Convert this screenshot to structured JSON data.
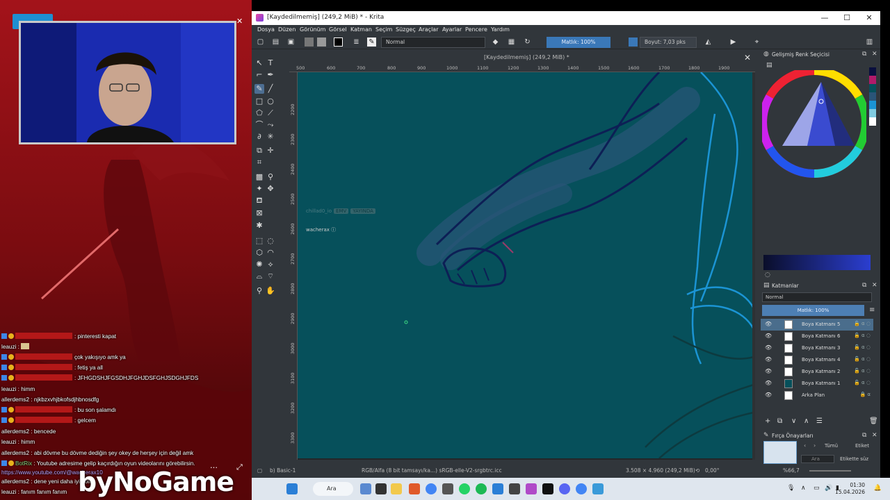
{
  "stream": {
    "chat_lines": [
      {
        "user": "",
        "text": ": pinteresti kapat",
        "badges": 2,
        "redacted": true
      },
      {
        "user": "leauzi",
        "text": " : ",
        "badges": 0,
        "redacted": false
      },
      {
        "user": "",
        "text": "çok yakışıyo amk ya",
        "badges": 2,
        "redacted": true
      },
      {
        "user": "",
        "text": ": fetiş ya all",
        "badges": 2,
        "redacted": true
      },
      {
        "user": "",
        "text": ": JFHGDSHJFGSDHJFGHJDSFGHJSDGHJFDS",
        "badges": 2,
        "redacted": true
      },
      {
        "user": "leauzi",
        "text": " : himm",
        "badges": 0,
        "redacted": false
      },
      {
        "user": "allerdems2",
        "text": " : njkbzxvhjbkofsdjhbnosdfg",
        "badges": 0,
        "redacted": false
      },
      {
        "user": "",
        "text": ": bu son şalamdı",
        "badges": 2,
        "redacted": true
      },
      {
        "user": "",
        "text": ": gelcem",
        "badges": 2,
        "redacted": true
      },
      {
        "user": "allerdems2",
        "text": " : bencede",
        "badges": 0,
        "redacted": false
      },
      {
        "user": "leauzi",
        "text": " : himm",
        "badges": 0,
        "redacted": false
      },
      {
        "user": "allerdems2",
        "text": " : abi dövme bu dövme dediğin şey okey de herşey için değil amk",
        "badges": 0,
        "redacted": false
      },
      {
        "user": "BotRix",
        "text": " : Youtube adresime gelip kaçırdığın oyun videolarını görebilirsin.",
        "badges": 2,
        "redacted": false
      },
      {
        "user": "",
        "text": "https://www.youtube.com/@wacherax10",
        "badges": 0,
        "redacted": false,
        "link": true
      },
      {
        "user": "allerdems2",
        "text": " : dene yeni daha iyi nolll",
        "badges": 0,
        "redacted": false
      },
      {
        "user": "leauzi",
        "text": " : fanım fanım fanım",
        "badges": 0,
        "redacted": false
      }
    ],
    "logo": "byNoGame"
  },
  "krita": {
    "title": "[Kaydedilmemiş] (249,2 MiB) * - Krita",
    "window_buttons": [
      "—",
      "☐",
      "✕"
    ],
    "menu": [
      "Dosya",
      "Düzen",
      "Görünüm",
      "Görsel",
      "Katman",
      "Seçim",
      "Süzgeç",
      "Araçlar",
      "Ayarlar",
      "Pencere",
      "Yardım"
    ],
    "toolbar": {
      "blend_mode": "Normal",
      "opacity": "Matlık: 100%",
      "size": "Boyut: 7,03 pks"
    },
    "doc_tab": "[Kaydedilmemiş] (249,2 MiB) *",
    "ruler_top": [
      "500",
      "600",
      "700",
      "800",
      "900",
      "1000",
      "1100",
      "1200",
      "1300",
      "1400",
      "1500",
      "1600",
      "1700",
      "1800",
      "1900"
    ],
    "ruler_left": [
      "2200",
      "2300",
      "2400",
      "2500",
      "2600",
      "2700",
      "2800",
      "2900",
      "3000",
      "3100",
      "3200",
      "3300",
      "3400"
    ],
    "canvas_overlay": {
      "user": "wacherax",
      "ghost_user": "chillad0_io",
      "ghost_tag1": "EMV",
      "ghost_tag2": "YAYINDA"
    },
    "status": {
      "brush": "b) Basic-1",
      "colorspace": "RGB/Alfa (8 bit tamsayı/ka...) sRGB-elle-V2-srgbtrc.icc",
      "dimensions": "3.508 × 4.960 (249,2 MiB)",
      "rotation": "0,00°",
      "zoom": "%66,7"
    },
    "dockers": {
      "color_selector_title": "Gelişmiş Renk Seçicisi",
      "layers_title": "Katmanlar",
      "layers_blend": "Normal",
      "layers_opacity": "Matlık: 100%",
      "layers": [
        {
          "name": "Boya Katmanı 5",
          "selected": true
        },
        {
          "name": "Boya Katmanı 6",
          "selected": false
        },
        {
          "name": "Boya Katmanı 3",
          "selected": false
        },
        {
          "name": "Boya Katmanı 4",
          "selected": false
        },
        {
          "name": "Boya Katmanı 2",
          "selected": false
        },
        {
          "name": "Boya Katmanı 1",
          "selected": false
        },
        {
          "name": "Arka Plan",
          "selected": false
        }
      ],
      "brush_presets_title": "Fırça Önayarları",
      "brush_filter": "Tümü",
      "brush_tag": "Etiket",
      "brush_search": "Ara",
      "brush_tag_filter": "Etikette süz"
    },
    "colors": {
      "canvas": "#06505b",
      "ui_bg": "#31363b",
      "accent": "#3a78b8"
    }
  },
  "taskbar": {
    "search": "Ara",
    "time": "01:30",
    "date": "15.04.2026"
  }
}
